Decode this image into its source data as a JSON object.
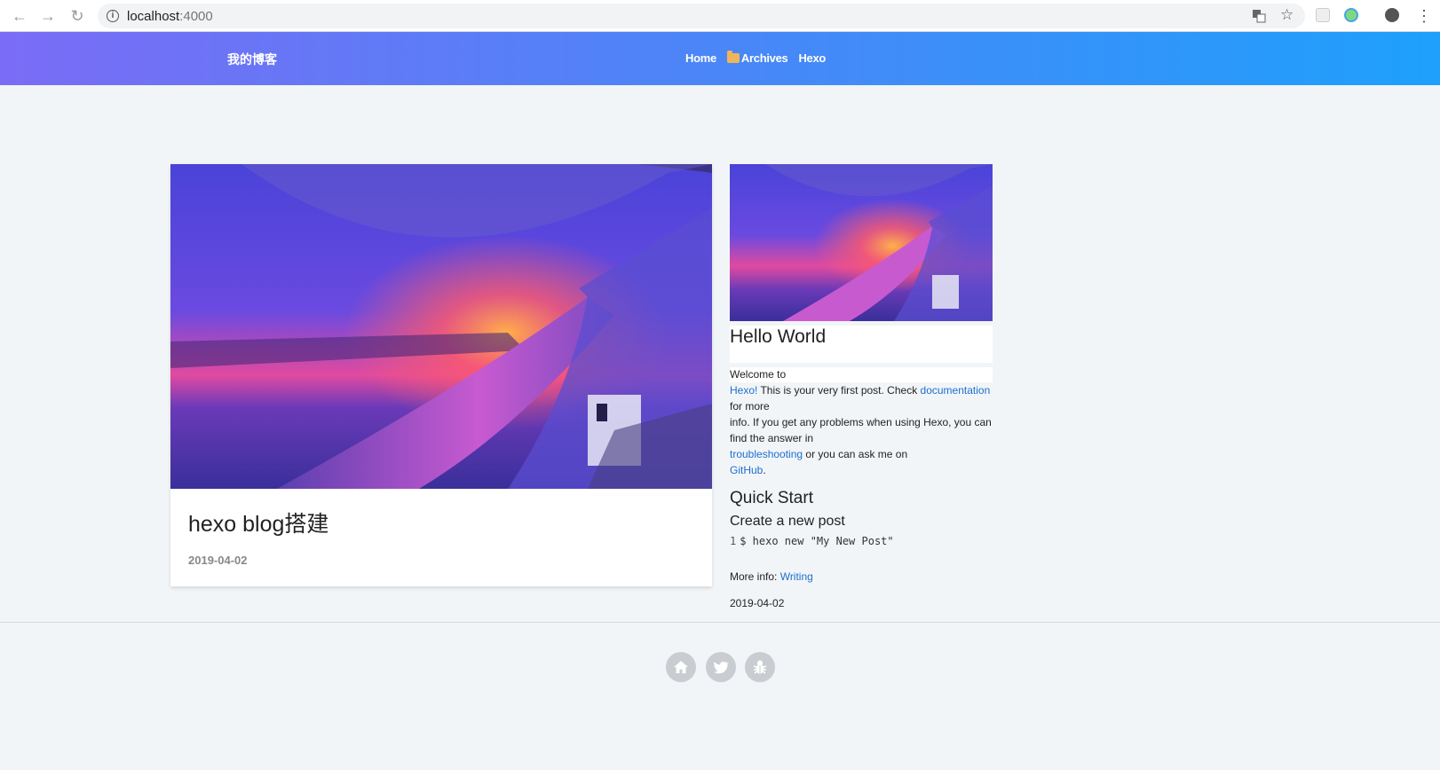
{
  "browser": {
    "url_host": "localhost",
    "url_port": ":4000"
  },
  "header": {
    "brand": "我的博客",
    "menu": [
      {
        "label": "Home"
      },
      {
        "label": "Archives"
      },
      {
        "label": "Hexo"
      }
    ]
  },
  "featured_post": {
    "title": "hexo blog搭建",
    "date": "2019-04-02"
  },
  "side_post": {
    "title": "Hello World",
    "welcome": "Welcome to",
    "hexo_link": "Hexo!",
    "text_after_hexo": " This is your very first post. Check ",
    "doc_link": "documentation",
    "for_more": "for more",
    "info_line": "info. If you get any problems when using Hexo, you can find the answer in",
    "troubleshooting_link": "troubleshooting",
    "ask_text": " or you can ask me on",
    "github_link": "GitHub",
    "period": ".",
    "quick_start": "Quick Start",
    "create_post": "Create a new post",
    "code_line_no": "1",
    "code": "$ hexo new \"My New Post\"",
    "more_info_label": "More info: ",
    "writing_link": "Writing",
    "date": "2019-04-02"
  },
  "footer": {
    "icons": [
      "home-icon",
      "twitter-icon",
      "bug-icon"
    ]
  },
  "colors": {
    "header_start": "#7b6cf6",
    "header_end": "#1ea0fc",
    "link": "#1e6fcf",
    "background": "#f2f5f7"
  }
}
